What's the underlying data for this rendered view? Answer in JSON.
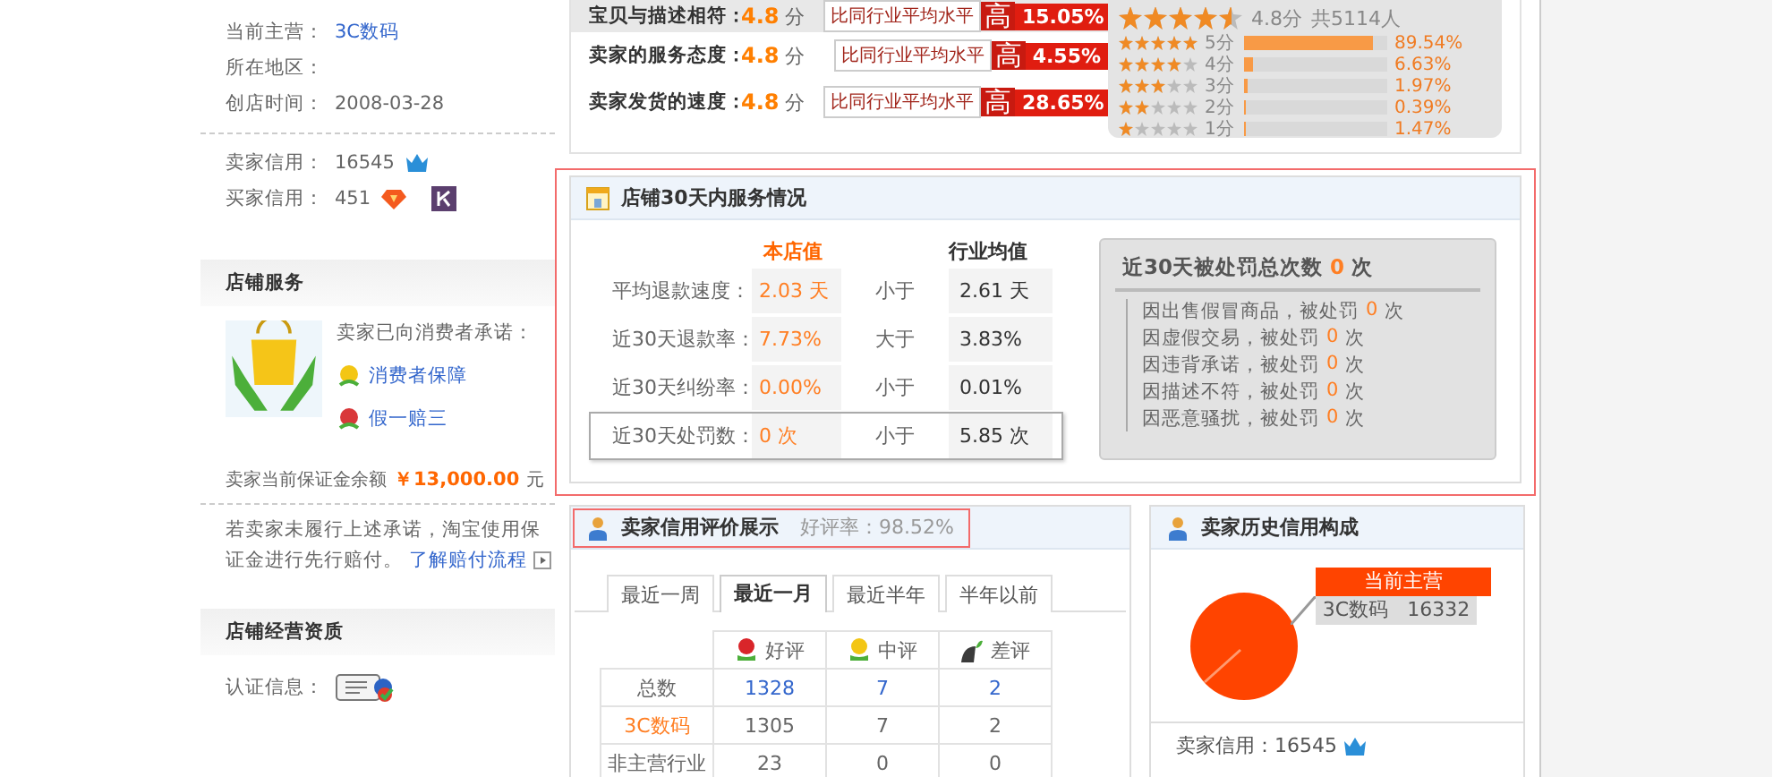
{
  "sidebar": {
    "info": [
      {
        "label": "当前主营：",
        "value": "3C数码",
        "kind": "link"
      },
      {
        "label": "所在地区："
      },
      {
        "label": "创店时间：",
        "value": "2008-03-28",
        "kind": "text"
      }
    ],
    "credits": [
      {
        "label": "卖家信用：",
        "value": "16545",
        "kind": "crown"
      },
      {
        "label": "买家信用：",
        "value": "451",
        "kind": "diamond"
      }
    ],
    "service": {
      "title": "店铺服务",
      "promise": "卖家已向消费者承诺：",
      "guarantees": [
        {
          "label": "消费者保障",
          "kind": "shield"
        },
        {
          "label": "假一赔三",
          "kind": "tag"
        }
      ],
      "deposit_label": "卖家当前保证金余额",
      "deposit_amount": "￥13,000.00",
      "deposit_unit": "元",
      "note": "若卖家未履行上述承诺，淘宝使用保证金进行先行赔付。",
      "note_link": "了解赔付流程"
    },
    "qualification": {
      "title": "店铺经营资质",
      "label": "认证信息："
    }
  },
  "ratings": [
    {
      "label": "宝贝与描述相符：",
      "score": "4.8",
      "unit": "分",
      "compare": "比同行业平均水平",
      "trend": "高",
      "percent": "15.05%",
      "highlighted": true
    },
    {
      "label": "卖家的服务态度：",
      "score": "4.8",
      "unit": "分",
      "compare": "比同行业平均水平",
      "trend": "高",
      "percent": "4.55%",
      "highlighted": false
    },
    {
      "label": "卖家发货的速度：",
      "score": "4.8",
      "unit": "分",
      "compare": "比同行业平均水平",
      "trend": "高",
      "percent": "28.65%",
      "highlighted": false
    }
  ],
  "summary": {
    "stars": 4.5,
    "score": "4.8分",
    "count": "共5114人",
    "distribution": [
      {
        "stars": 5,
        "label": "5分",
        "level": 0.8954,
        "percent": "89.54%"
      },
      {
        "stars": 4,
        "label": "4分",
        "level": 0.0663,
        "percent": "6.63%"
      },
      {
        "stars": 3,
        "label": "3分",
        "level": 0.0197,
        "percent": "1.97%"
      },
      {
        "stars": 2,
        "label": "2分",
        "level": 0.0039,
        "percent": "0.39%"
      },
      {
        "stars": 1,
        "label": "1分",
        "level": 0.0147,
        "percent": "1.47%"
      }
    ]
  },
  "service_box": {
    "title": "店铺30天内服务情况",
    "header_store": "本店值",
    "header_avg": "行业均值",
    "rows": [
      {
        "label": "平均退款速度：",
        "value": "2.03 天",
        "relation": "小于",
        "average": "2.61 天",
        "selected": false
      },
      {
        "label": "近30天退款率：",
        "value": "7.73%",
        "relation": "大于",
        "average": "3.83%",
        "selected": false
      },
      {
        "label": "近30天纠纷率：",
        "value": "0.00%",
        "relation": "小于",
        "average": "0.01%",
        "selected": false
      },
      {
        "label": "近30天处罚数：",
        "value": "0 次",
        "relation": "小于",
        "average": "5.85 次",
        "selected": true
      }
    ],
    "penalty": {
      "title": "近30天被处罚总次数",
      "count": "0",
      "unit": "次",
      "items": [
        {
          "text": "因出售假冒商品，被处罚",
          "count": "0",
          "unit": "次"
        },
        {
          "text": "因虚假交易，被处罚",
          "count": "0",
          "unit": "次"
        },
        {
          "text": "因违背承诺，被处罚",
          "count": "0",
          "unit": "次"
        },
        {
          "text": "因描述不符，被处罚",
          "count": "0",
          "unit": "次"
        },
        {
          "text": "因恶意骚扰，被处罚",
          "count": "0",
          "unit": "次"
        }
      ]
    }
  },
  "credit_panel": {
    "title": "卖家信用评价展示",
    "rate": "好评率：98.52%",
    "tabs": [
      {
        "label": "最近一周",
        "selected": false
      },
      {
        "label": "最近一月",
        "selected": true
      },
      {
        "label": "最近半年",
        "selected": false
      },
      {
        "label": "半年以前",
        "selected": false
      }
    ],
    "columns": [
      {
        "label": "好评",
        "kind": "good"
      },
      {
        "label": "中评",
        "kind": "neutral"
      },
      {
        "label": "差评",
        "kind": "bad"
      }
    ],
    "rows": [
      {
        "label": "总数",
        "kind": "plain",
        "values": [
          "1328",
          "7",
          "2"
        ],
        "link": true
      },
      {
        "label": "3C数码",
        "kind": "accent",
        "values": [
          "1305",
          "7",
          "2"
        ],
        "link": false
      },
      {
        "label": "非主营行业",
        "kind": "plain",
        "values": [
          "23",
          "0",
          "0"
        ],
        "link": false
      }
    ]
  },
  "history": {
    "title": "卖家历史信用构成",
    "callout_title": "当前主营",
    "callout_text": "3C数码   16332",
    "seller_credit": "卖家信用：16545"
  }
}
